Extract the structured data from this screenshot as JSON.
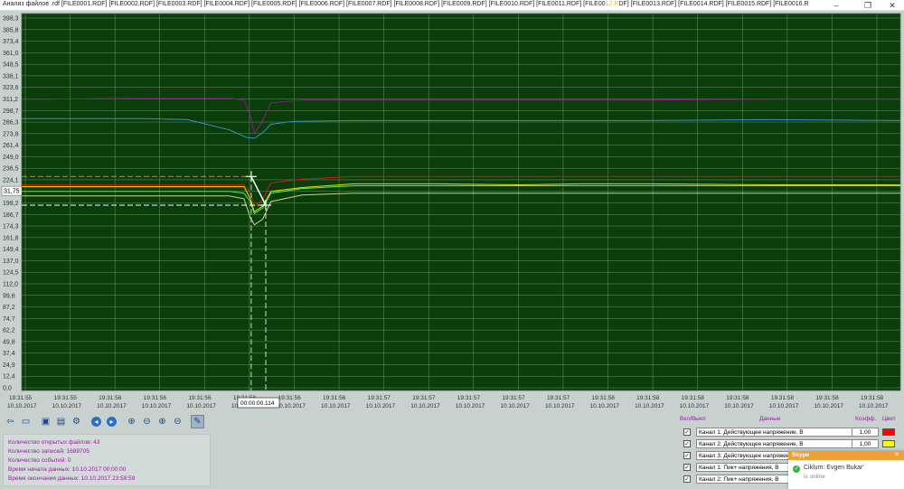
{
  "window": {
    "title_prefix": "Анализ файлов .rdf [FILE0001.RDF] [FILE0002.RDF] [FILE0003.RDF] [FILE0004.RDF] [FILE0005.RDF] [FILE0006.RDF] [FILE0007.RDF] [FILE0008.RDF] [FILE0009.RDF] [FILE0010.RDF] [FILE0011.RDF] [FILE00",
    "title_highlight": "12.R",
    "title_suffix": "DF] [FILE0013.RDF] [FILE0014.RDF] [FILE0015.RDF] [FILE0016.R",
    "min_glyph": "–",
    "max_glyph": "❐",
    "close_glyph": "✕"
  },
  "chart_data": {
    "type": "line",
    "ylim": [
      0,
      405
    ],
    "y_ticks": [
      "398,3",
      "385,8",
      "373,4",
      "361,0",
      "348,5",
      "336,1",
      "323,6",
      "311,2",
      "298,7",
      "286,3",
      "273,8",
      "261,4",
      "249,0",
      "236,5",
      "224,1",
      "211,6",
      "199,2",
      "186,7",
      "174,3",
      "161,8",
      "149,4",
      "137,0",
      "124,5",
      "112,0",
      "99,6",
      "87,2",
      "74,7",
      "62,2",
      "49,8",
      "37,4",
      "24,9",
      "12,4",
      "0,0"
    ],
    "x_ticks": [
      {
        "time": "19:31:55",
        "date": "10.10.2017"
      },
      {
        "time": "19:31:55",
        "date": "10.10.2017"
      },
      {
        "time": "19:31:56",
        "date": "10.10.2017"
      },
      {
        "time": "19:31:56",
        "date": "10.10.2017"
      },
      {
        "time": "19:31:56",
        "date": "10.10.2017"
      },
      {
        "time": "19:31:56",
        "date": "10.10.2017"
      },
      {
        "time": "19:31:56",
        "date": "10.10.2017"
      },
      {
        "time": "19:31:56",
        "date": "10.10.2017"
      },
      {
        "time": "19:31:57",
        "date": "10.10.2017"
      },
      {
        "time": "19:31:57",
        "date": "10.10.2017"
      },
      {
        "time": "19:31:57",
        "date": "10.10.2017"
      },
      {
        "time": "19:31:57",
        "date": "10.10.2017"
      },
      {
        "time": "19:31:57",
        "date": "10.10.2017"
      },
      {
        "time": "19:31:58",
        "date": "10.10.2017"
      },
      {
        "time": "19:31:58",
        "date": "10.10.2017"
      },
      {
        "time": "19:31:58",
        "date": "10.10.2017"
      },
      {
        "time": "19:31:58",
        "date": "10.10.2017"
      },
      {
        "time": "19:31:58",
        "date": "10.10.2017"
      },
      {
        "time": "19:31:58",
        "date": "10.10.2017"
      },
      {
        "time": "19:31:58",
        "date": "10.10.2017"
      }
    ],
    "series": [
      {
        "name": "Канал 1: Действующее напряжение, В",
        "color": "#cc1a1a",
        "x": [
          0,
          8,
          60,
          100,
          107,
          110,
          112,
          116,
          120,
          135,
          160,
          200,
          240,
          270,
          300,
          360,
          423
        ],
        "y": [
          221,
          221,
          221,
          221,
          221,
          212,
          198,
          205,
          223,
          227,
          230,
          230,
          230,
          230,
          230,
          230,
          230
        ]
      },
      {
        "name": "Канал 2: Действующее напряжение, В",
        "color": "#e6e000",
        "x": [
          0,
          8,
          60,
          100,
          107,
          110,
          112,
          116,
          120,
          135,
          160,
          200,
          240,
          270,
          300,
          360,
          423
        ],
        "y": [
          219,
          219,
          219,
          219,
          219,
          206,
          192,
          198,
          214,
          218,
          222,
          222,
          221,
          222,
          222,
          221,
          221
        ]
      },
      {
        "name": "Канал 3: Действующее напряжение, В",
        "color": "#55ee55",
        "x": [
          0,
          8,
          60,
          100,
          107,
          110,
          112,
          116,
          120,
          135,
          160,
          200,
          240,
          270,
          300,
          360,
          423
        ],
        "y": [
          214,
          214,
          214,
          214,
          212,
          203,
          190,
          196,
          212,
          217,
          220,
          220,
          220,
          220,
          220,
          220,
          220
        ]
      },
      {
        "name": "Канал 1: Пик+ напряжения, В",
        "color": "#c8d880",
        "x": [
          0,
          8,
          60,
          100,
          107,
          110,
          112,
          116,
          120,
          135,
          160,
          200,
          240,
          270,
          300,
          360,
          423
        ],
        "y": [
          209,
          209,
          209,
          209,
          206,
          186,
          178,
          184,
          203,
          210,
          212,
          212,
          212,
          212,
          212,
          212,
          212
        ]
      },
      {
        "name": "Канал 2: Пик+ напряжения, В",
        "color": "#3a8fc8",
        "x": [
          0,
          8,
          60,
          80,
          100,
          108,
          112,
          116,
          120,
          130,
          160,
          200,
          240,
          270,
          300,
          360,
          423
        ],
        "y": [
          292,
          292,
          292,
          291,
          280,
          272,
          271,
          277,
          286,
          289,
          290,
          290,
          290,
          290,
          290,
          291,
          290
        ]
      },
      {
        "name": "",
        "color": "#8b1a8b",
        "x": [
          0,
          8,
          60,
          100,
          107,
          110,
          112,
          116,
          120,
          135,
          160,
          200,
          240,
          270,
          300,
          360,
          423
        ],
        "y": [
          313,
          313,
          314,
          314,
          312,
          295,
          276,
          290,
          309,
          312,
          312,
          312,
          312,
          312,
          312,
          313,
          313
        ]
      }
    ],
    "cursor": {
      "x1": 110.5,
      "y1": 229.9,
      "x2": 117.5,
      "y2": 199.1,
      "y_label": "31,75",
      "x_label": "00:00:00.114"
    },
    "grid": true
  },
  "toolbar": {
    "icons": [
      "door-exit-icon",
      "folder-open-icon",
      "save-icon",
      "print-icon",
      "settings-gear-icon",
      "arrow-left-icon",
      "arrow-right-icon",
      "zoom-in-icon",
      "zoom-out-icon",
      "zoom-in-y-icon",
      "zoom-out-y-icon",
      "measure-tool-icon"
    ]
  },
  "info": {
    "files_open": "Количество открытых файлов: 43",
    "records": "Количество записей: 1689705",
    "events": "Количество событий: 0",
    "start": "Время начала данных: 10.10.2017 00:00:00",
    "end": "Время окончания данных: 10.10.2017 23:59:59"
  },
  "channels": {
    "header_on": "Вкл/Выкл",
    "header_data": "Данные",
    "header_coef": "Коэфф.",
    "header_color": "Цвет",
    "rows": [
      {
        "label": "Канал 1: Действующее напряжение, В",
        "coef": "1,00",
        "color": "#ff0000"
      },
      {
        "label": "Канал 2: Действующее напряжение, В",
        "coef": "1,00",
        "color": "#ffff00"
      },
      {
        "label": "Канал 3: Действующее напряжение, В",
        "coef": "",
        "color": ""
      },
      {
        "label": "Канал 1: Пик+ напряжения, В",
        "coef": "",
        "color": ""
      },
      {
        "label": "Канал 2: Пик+ напряжения, В",
        "coef": "",
        "color": ""
      }
    ]
  },
  "toast": {
    "brand": "Skype",
    "message": "Ciklum: Evgen Bukar'",
    "status": "is online"
  }
}
